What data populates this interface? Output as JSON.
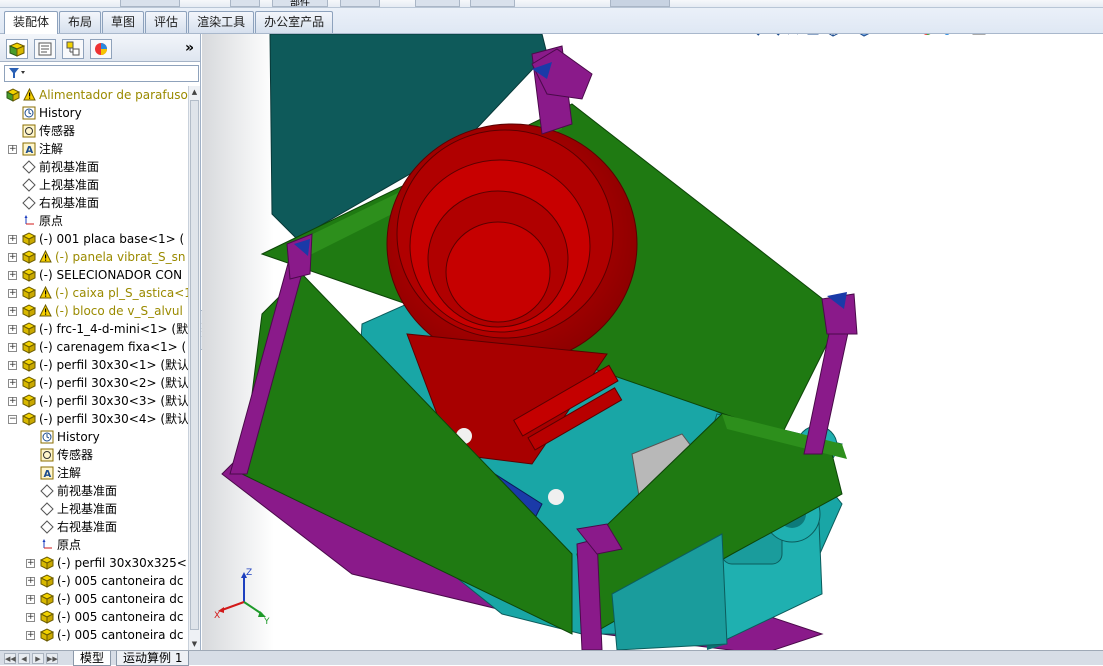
{
  "command_tabs": [
    {
      "label": "装配体",
      "active": true
    },
    {
      "label": "布局",
      "active": false
    },
    {
      "label": "草图",
      "active": false
    },
    {
      "label": "评估",
      "active": false
    },
    {
      "label": "渲染工具",
      "active": false
    },
    {
      "label": "办公室产品",
      "active": false
    }
  ],
  "ribbon_peek": "部件",
  "feature_manager": {
    "tabs": [
      "featuremanager-tree-icon",
      "property-manager-icon",
      "configuration-manager-icon",
      "display-manager-icon"
    ],
    "more_label": "»",
    "tree": [
      {
        "label": "Alimentador de parafuso",
        "icon": "assembly-icon",
        "warning": true,
        "level": 0,
        "expander": ""
      },
      {
        "label": "History",
        "icon": "history-icon",
        "level": 1,
        "expander": ""
      },
      {
        "label": "传感器",
        "icon": "sensor-icon",
        "level": 1,
        "expander": ""
      },
      {
        "label": "注解",
        "icon": "annotation-icon",
        "level": 1,
        "expander": "+"
      },
      {
        "label": "前视基准面",
        "icon": "plane-icon",
        "level": 1,
        "expander": ""
      },
      {
        "label": "上视基准面",
        "icon": "plane-icon",
        "level": 1,
        "expander": ""
      },
      {
        "label": "右视基准面",
        "icon": "plane-icon",
        "level": 1,
        "expander": ""
      },
      {
        "label": "原点",
        "icon": "origin-icon",
        "level": 1,
        "expander": ""
      },
      {
        "label": "(-) 001 placa base<1> (",
        "icon": "part-icon",
        "level": 1,
        "expander": "+"
      },
      {
        "label": "(-) panela vibrat_S_sn",
        "icon": "part-icon",
        "warning": true,
        "level": 1,
        "expander": "+"
      },
      {
        "label": "(-) SELECIONADOR CON",
        "icon": "part-icon",
        "level": 1,
        "expander": "+"
      },
      {
        "label": "(-) caixa pl_S_astica<1",
        "icon": "part-icon",
        "warning": true,
        "level": 1,
        "expander": "+"
      },
      {
        "label": "(-) bloco de v_S_alvul",
        "icon": "part-icon",
        "warning": true,
        "level": 1,
        "expander": "+"
      },
      {
        "label": "(-) frc-1_4-d-mini<1> (默",
        "icon": "part-icon",
        "level": 1,
        "expander": "+"
      },
      {
        "label": "(-) carenagem fixa<1> (",
        "icon": "part-icon",
        "level": 1,
        "expander": "+"
      },
      {
        "label": "(-) perfil 30x30<1> (默认",
        "icon": "part-icon",
        "level": 1,
        "expander": "+"
      },
      {
        "label": "(-) perfil 30x30<2> (默认",
        "icon": "part-icon",
        "level": 1,
        "expander": "+"
      },
      {
        "label": "(-) perfil 30x30<3> (默认",
        "icon": "part-icon",
        "level": 1,
        "expander": "+"
      },
      {
        "label": "(-) perfil 30x30<4> (默认",
        "icon": "part-icon",
        "level": 1,
        "expander": "−"
      },
      {
        "label": "History",
        "icon": "history-icon",
        "level": 2,
        "expander": ""
      },
      {
        "label": "传感器",
        "icon": "sensor-icon",
        "level": 2,
        "expander": ""
      },
      {
        "label": "注解",
        "icon": "annotation-icon",
        "level": 2,
        "expander": ""
      },
      {
        "label": "前视基准面",
        "icon": "plane-icon",
        "level": 2,
        "expander": ""
      },
      {
        "label": "上视基准面",
        "icon": "plane-icon",
        "level": 2,
        "expander": ""
      },
      {
        "label": "右视基准面",
        "icon": "plane-icon",
        "level": 2,
        "expander": ""
      },
      {
        "label": "原点",
        "icon": "origin-icon",
        "level": 2,
        "expander": ""
      },
      {
        "label": "(-) perfil 30x30x325<",
        "icon": "part-icon",
        "level": 2,
        "expander": "+"
      },
      {
        "label": "(-) 005 cantoneira dc",
        "icon": "part-icon",
        "level": 2,
        "expander": "+"
      },
      {
        "label": "(-) 005 cantoneira dc",
        "icon": "part-icon",
        "level": 2,
        "expander": "+"
      },
      {
        "label": "(-) 005 cantoneira dc",
        "icon": "part-icon",
        "level": 2,
        "expander": "+"
      },
      {
        "label": "(-) 005 cantoneira dc",
        "icon": "part-icon",
        "level": 2,
        "expander": "+"
      }
    ]
  },
  "bottom_tabs": [
    {
      "label": "模型",
      "active": true
    },
    {
      "label": "运动算例 1",
      "active": false
    }
  ],
  "triad": {
    "x": "X",
    "y": "Y",
    "z": "Z"
  },
  "heads_up_toolbar": [
    "zoom-to-fit-icon",
    "zoom-to-area-icon",
    "previous-view-icon",
    "section-view-icon",
    "view-orientation-icon",
    "display-style-icon",
    "hide-show-items-icon",
    "edit-appearance-icon",
    "apply-scene-icon",
    "view-settings-icon"
  ],
  "colors": {
    "bowl": "#c40000",
    "panel": "#1f7a12",
    "frame": "#8a1a8a",
    "base": "#19a6a6",
    "accent_blue": "#1a3aa8"
  }
}
